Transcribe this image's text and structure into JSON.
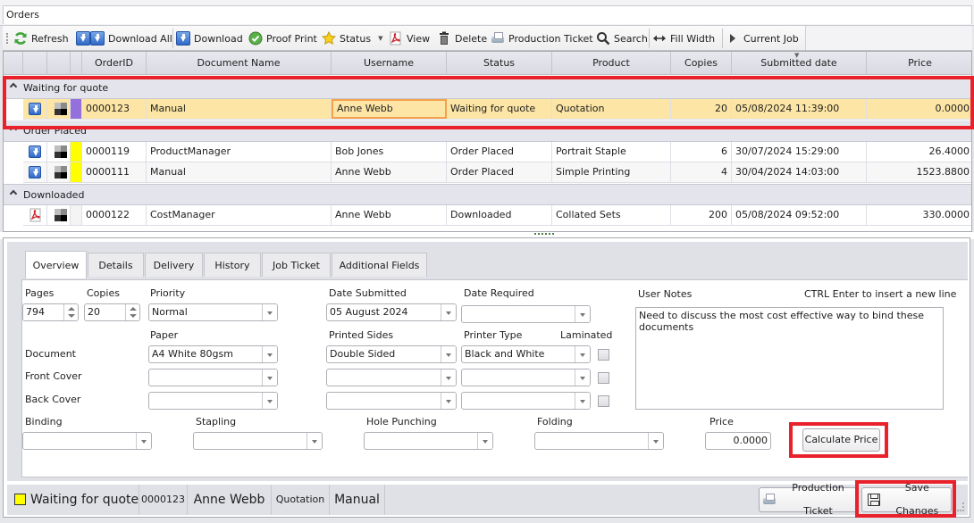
{
  "window": {
    "title": "Orders"
  },
  "toolbar": {
    "items": [
      {
        "label": "Refresh",
        "icon": "refresh-icon"
      },
      {
        "label": "Download All",
        "icon": "download-all-icon"
      },
      {
        "label": "Download",
        "icon": "download-icon"
      },
      {
        "label": "Proof Print",
        "icon": "check-circle-icon"
      },
      {
        "label": "Status",
        "icon": "star-icon",
        "dropdown": true
      },
      {
        "label": "View",
        "icon": "pdf-icon"
      },
      {
        "label": "Delete",
        "icon": "trash-icon"
      },
      {
        "label": "Production Ticket",
        "icon": "printer-icon"
      },
      {
        "label": "Search",
        "icon": "search-icon"
      },
      {
        "label": "Fill Width",
        "icon": "arrows-horizontal-icon"
      },
      {
        "label": "Current Job",
        "icon": "play-icon"
      }
    ]
  },
  "grid": {
    "columns": [
      "",
      "",
      "",
      "OrderID",
      "Document Name",
      "Username",
      "Status",
      "Product",
      "Copies",
      "Submitted date",
      "Price"
    ],
    "sort_column": "Submitted date",
    "groups": [
      {
        "label": "Waiting for quote",
        "rows": [
          {
            "icon": "download-icon",
            "color": "#9370db",
            "order_id": "0000123",
            "document": "Manual",
            "username": "Anne Webb",
            "status": "Waiting for quote",
            "product": "Quotation",
            "copies": "20",
            "submitted": "05/08/2024 11:39:00",
            "price": "0.0000",
            "selected": true
          }
        ]
      },
      {
        "label": "Order Placed",
        "rows": [
          {
            "icon": "download-icon",
            "color": "#ffff00",
            "order_id": "0000119",
            "document": "ProductManager",
            "username": "Bob Jones",
            "status": "Order Placed",
            "product": "Portrait Staple",
            "copies": "6",
            "submitted": "30/07/2024 15:29:00",
            "price": "26.4000"
          },
          {
            "icon": "download-icon",
            "color": "#ffff00",
            "order_id": "0000111",
            "document": "Manual",
            "username": "Anne Webb",
            "status": "Order Placed",
            "product": "Simple Printing",
            "copies": "4",
            "submitted": "30/04/2024 14:03:00",
            "price": "1523.8800"
          }
        ]
      },
      {
        "label": "Downloaded",
        "rows": [
          {
            "icon": "pdf-icon",
            "color": "",
            "order_id": "0000122",
            "document": "CostManager",
            "username": "Anne Webb",
            "status": "Downloaded",
            "product": "Collated Sets",
            "copies": "200",
            "submitted": "05/08/2024 09:52:00",
            "price": "330.0000"
          }
        ]
      }
    ]
  },
  "details": {
    "tabs": [
      "Overview",
      "Details",
      "Delivery",
      "History",
      "Job Ticket",
      "Additional Fields"
    ],
    "active_tab": "Overview",
    "overview": {
      "pages_label": "Pages",
      "pages_value": "794",
      "copies_label": "Copies",
      "copies_value": "20",
      "priority_label": "Priority",
      "priority_value": "Normal",
      "date_submitted_label": "Date Submitted",
      "date_submitted_value": "05 August 2024",
      "date_required_label": "Date Required",
      "date_required_value": "",
      "paper_label": "Paper",
      "printed_sides_label": "Printed Sides",
      "printer_type_label": "Printer Type",
      "laminated_label": "Laminated",
      "rows": [
        {
          "label": "Document",
          "paper": "A4 White 80gsm",
          "printed_sides": "Double Sided",
          "printer_type": "Black and White",
          "laminated": false
        },
        {
          "label": "Front Cover",
          "paper": "",
          "printed_sides": "",
          "printer_type": "",
          "laminated": false
        },
        {
          "label": "Back Cover",
          "paper": "",
          "printed_sides": "",
          "printer_type": "",
          "laminated": false
        }
      ],
      "user_notes_label": "User Notes",
      "user_notes_hint": "CTRL Enter to insert a new line",
      "user_notes_value": "Need to discuss the most cost effective way to bind these documents",
      "binding_label": "Binding",
      "binding_value": "",
      "stapling_label": "Stapling",
      "stapling_value": "",
      "hole_punching_label": "Hole Punching",
      "hole_punching_value": "",
      "folding_label": "Folding",
      "folding_value": "",
      "price_label": "Price",
      "price_value": "0.0000",
      "calculate_price_label": "Calculate Price"
    }
  },
  "statusbar": {
    "status": "Waiting for quote",
    "status_color": "#ffff00",
    "order_id": "0000123",
    "username": "Anne Webb",
    "product": "Quotation",
    "document": "Manual",
    "production_ticket_label": "Production Ticket",
    "save_changes_label": "Save Changes"
  },
  "highlight_color": "#e8212b"
}
